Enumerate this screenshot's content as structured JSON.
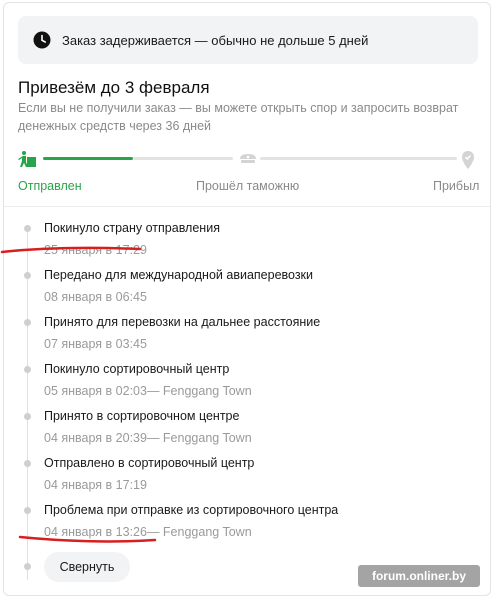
{
  "banner": {
    "text": "Заказ задерживается — обычно не дольше 5 дней",
    "icon": "clock-icon"
  },
  "delivery": {
    "title": "Привезём до 3 февраля",
    "subtitle": "Если вы не получили заказ — вы можете открыть спор и запросить возврат денежных средств через 36 дней"
  },
  "progress": {
    "steps": [
      {
        "label": "Отправлен",
        "icon": "shipped-icon",
        "status": "done"
      },
      {
        "label": "Прошёл таможню",
        "icon": "customs-icon",
        "status": "pending"
      },
      {
        "label": "Прибыл",
        "icon": "location-pin-icon",
        "status": "pending"
      }
    ],
    "accent_color": "#2aa44a",
    "inactive_color": "#d4d4d4"
  },
  "events": [
    {
      "title": "Покинуло страну отправления",
      "date": "25 января в 17:29"
    },
    {
      "title": "Передано для международной авиаперевозки",
      "date": "08 января в 06:45"
    },
    {
      "title": "Принято для перевозки на дальнее расстояние",
      "date": "07 января в 03:45"
    },
    {
      "title": "Покинуло сортировочный центр",
      "date": "05 января в 02:03— Fenggang Town"
    },
    {
      "title": "Принято в сортировочном центре",
      "date": "04 января в 20:39— Fenggang Town"
    },
    {
      "title": "Отправлено в сортировочный центр",
      "date": "04 января в 17:19"
    },
    {
      "title": "Проблема при отправке из сортировочного центра",
      "date": "04 января в 13:26— Fenggang Town"
    }
  ],
  "collapse_label": "Свернуть",
  "watermark": "forum.onliner.by",
  "annotation_color": "#d61f1f"
}
